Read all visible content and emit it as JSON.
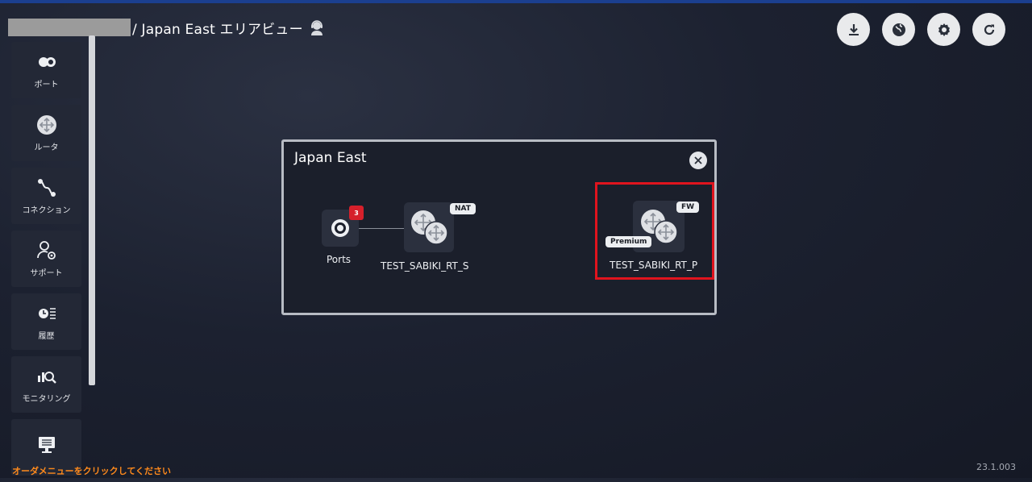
{
  "header": {
    "title": "/ Japan East エリアビュー",
    "user_icon": "user-headset-icon"
  },
  "actions": [
    {
      "name": "download-button",
      "icon": "download-icon"
    },
    {
      "name": "globe-button",
      "icon": "globe-icon"
    },
    {
      "name": "settings-button",
      "icon": "gear-icon"
    },
    {
      "name": "refresh-button",
      "icon": "refresh-icon"
    }
  ],
  "sidebar": {
    "items": [
      {
        "label": "ポート",
        "icon": "port-icon"
      },
      {
        "label": "ルータ",
        "icon": "router-icon"
      },
      {
        "label": "コネクション",
        "icon": "connection-icon"
      },
      {
        "label": "サポート",
        "icon": "support-icon"
      },
      {
        "label": "履歴",
        "icon": "history-icon"
      },
      {
        "label": "モニタリング",
        "icon": "monitoring-icon"
      },
      {
        "label": "",
        "icon": "order-menu-icon"
      }
    ]
  },
  "hint": "オーダメニューをクリックしてください",
  "version": "23.1.003",
  "panel": {
    "title": "Japan East",
    "ports": {
      "label": "Ports",
      "count": "3"
    },
    "router_s": {
      "label": "TEST_SABIKI_RT_S",
      "tag": "NAT"
    },
    "router_p": {
      "label": "TEST_SABIKI_RT_P",
      "tag": "FW",
      "tier": "Premium"
    }
  },
  "colors": {
    "accent_bar": "#1b3f8f",
    "hint": "#ff8a1c",
    "highlight": "#e0141e",
    "badge": "#d6202b"
  }
}
